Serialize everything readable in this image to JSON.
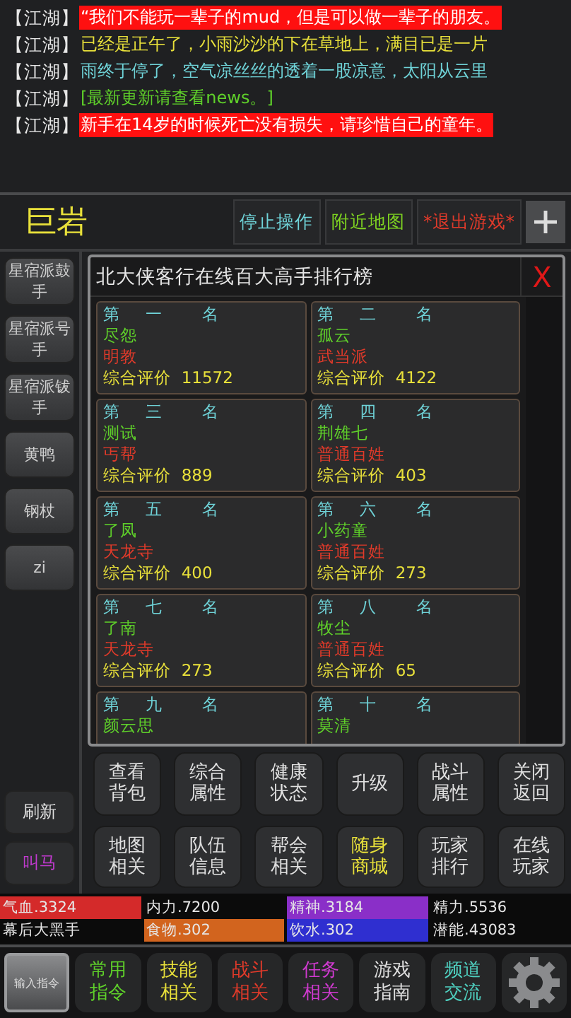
{
  "chat": [
    {
      "channel": "【江湖】",
      "text": "“我们不能玩一辈子的mud，但是可以做一辈子的朋友。",
      "highlighted": true
    },
    {
      "channel": "【江湖】",
      "text": "已经是正午了，小雨沙沙的下在草地上，满目已是一片",
      "color": "#e8e03a",
      "highlighted": false
    },
    {
      "channel": "【江湖】",
      "text": "雨终于停了，空气凉丝丝的透着一股凉意，太阳从云里",
      "color": "#6fd3d8",
      "highlighted": false
    },
    {
      "channel": "【江湖】",
      "text": "[最新更新请查看news。]",
      "color": "#5fd02a",
      "highlighted": false
    },
    {
      "channel": "【江湖】",
      "text": "新手在14岁的时候死亡没有损失，请珍惜自己的童年。",
      "highlighted": true
    }
  ],
  "location": "巨岩",
  "top_actions": [
    {
      "label": "停止操作",
      "color": "#6fd3d8"
    },
    {
      "label": "附近地图",
      "color": "#7ed321"
    },
    {
      "label": "*退出游戏*",
      "color": "#e03a2a"
    }
  ],
  "side_buttons": [
    "星宿派鼓手",
    "星宿派号手",
    "星宿派钹手",
    "黄鸭",
    "钢杖",
    "zi"
  ],
  "side_bottom": [
    {
      "label": "刷新",
      "color": "#e0e0e0"
    },
    {
      "label": "叫马",
      "color": "#c23ad0"
    }
  ],
  "ranking": {
    "title": "北大侠客行在线百大高手排行榜",
    "close": "X",
    "entries": [
      {
        "rank": [
          "第",
          "一",
          "名"
        ],
        "name": "尽怨",
        "sect": "明教",
        "score_label": "综合评价",
        "score": "11572"
      },
      {
        "rank": [
          "第",
          "二",
          "名"
        ],
        "name": "孤云",
        "sect": "武当派",
        "score_label": "综合评价",
        "score": "4122"
      },
      {
        "rank": [
          "第",
          "三",
          "名"
        ],
        "name": "测试",
        "sect": "丐帮",
        "score_label": "综合评价",
        "score": "889"
      },
      {
        "rank": [
          "第",
          "四",
          "名"
        ],
        "name": "荆雄七",
        "sect": "普通百姓",
        "score_label": "综合评价",
        "score": "403"
      },
      {
        "rank": [
          "第",
          "五",
          "名"
        ],
        "name": "了凤",
        "sect": "天龙寺",
        "score_label": "综合评价",
        "score": "400"
      },
      {
        "rank": [
          "第",
          "六",
          "名"
        ],
        "name": "小药童",
        "sect": "普通百姓",
        "score_label": "综合评价",
        "score": "273"
      },
      {
        "rank": [
          "第",
          "七",
          "名"
        ],
        "name": "了南",
        "sect": "天龙寺",
        "score_label": "综合评价",
        "score": "273"
      },
      {
        "rank": [
          "第",
          "八",
          "名"
        ],
        "name": "牧尘",
        "sect": "普通百姓",
        "score_label": "综合评价",
        "score": "65"
      },
      {
        "rank": [
          "第",
          "九",
          "名"
        ],
        "name": "颜云思"
      },
      {
        "rank": [
          "第",
          "十",
          "名"
        ],
        "name": "莫清"
      }
    ]
  },
  "menu_buttons": [
    {
      "label": "查看背包",
      "color": "#e0e0e0"
    },
    {
      "label": "综合属性",
      "color": "#e0e0e0"
    },
    {
      "label": "健康状态",
      "color": "#e0e0e0"
    },
    {
      "label": "升级",
      "color": "#e0e0e0"
    },
    {
      "label": "战斗属性",
      "color": "#e0e0e0"
    },
    {
      "label": "关闭返回",
      "color": "#e0e0e0"
    },
    {
      "label": "地图相关",
      "color": "#e0e0e0"
    },
    {
      "label": "队伍信息",
      "color": "#e0e0e0"
    },
    {
      "label": "帮会相关",
      "color": "#e0e0e0"
    },
    {
      "label": "随身商城",
      "color": "#e8e03a"
    },
    {
      "label": "玩家排行",
      "color": "#e0e0e0"
    },
    {
      "label": "在线玩家",
      "color": "#e0e0e0"
    }
  ],
  "stats": [
    {
      "label": "气血.3324",
      "color": "#d42a2a"
    },
    {
      "label": "内力.7200"
    },
    {
      "label": "精神.3184",
      "color": "#8a2fc8"
    },
    {
      "label": "精力.5536"
    },
    {
      "label": "幕后大黑手"
    },
    {
      "label": "食物.302",
      "color": "#d2641e"
    },
    {
      "label": "饮水.302",
      "color": "#2f2fd0"
    },
    {
      "label": "潜能.43083"
    }
  ],
  "input_button": "输入指令",
  "bottom_tabs": [
    {
      "label": "常用指令",
      "color": "#5fd02a"
    },
    {
      "label": "技能相关",
      "color": "#e8e03a"
    },
    {
      "label": "战斗相关",
      "color": "#e03a2a"
    },
    {
      "label": "任务相关",
      "color": "#d03ad0"
    },
    {
      "label": "游戏指南",
      "color": "#e0e0e0"
    },
    {
      "label": "频道交流",
      "color": "#4fd0c0"
    }
  ]
}
